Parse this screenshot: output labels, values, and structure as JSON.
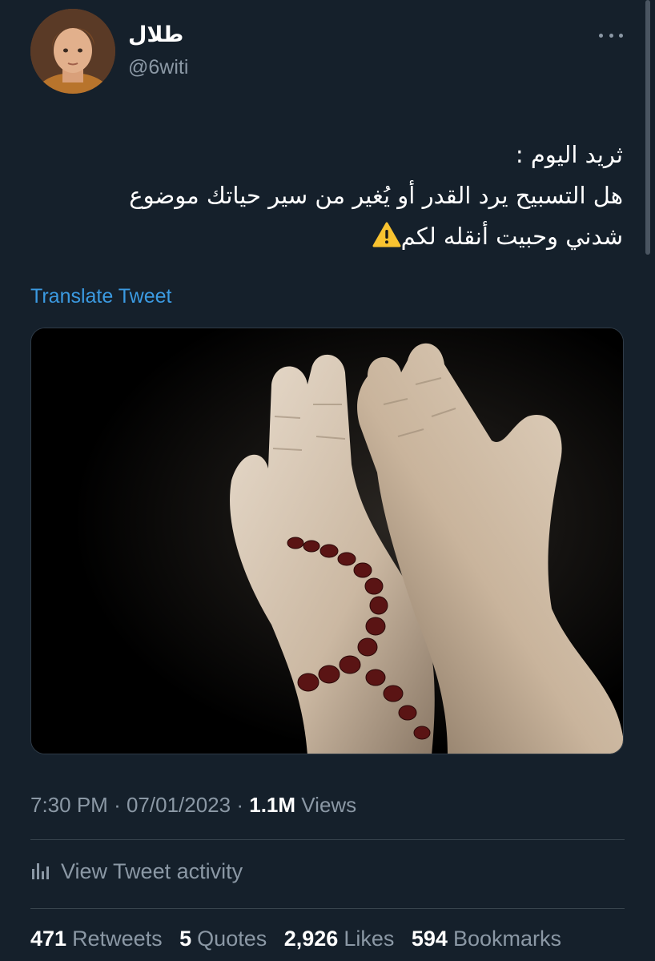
{
  "author": {
    "display_name": "طلال",
    "handle": "@6witi"
  },
  "tweet": {
    "lines": [
      "ثريد اليوم :",
      "هل التسبيح يرد القدر أو يُغير من سير حياتك موضوع",
      "شدني وحبيت أنقله لكم"
    ],
    "translate_label": "Translate Tweet",
    "media_icon": "praying-hands-with-prayer-beads-photo"
  },
  "meta": {
    "time": "7:30 PM",
    "separator": "·",
    "date": "07/01/2023",
    "views_count": "1.1M",
    "views_label": "Views"
  },
  "activity": {
    "label": "View Tweet activity",
    "icon": "bar-chart-icon"
  },
  "stats": {
    "retweets_count": "471",
    "retweets_label": "Retweets",
    "quotes_count": "5",
    "quotes_label": "Quotes",
    "likes_count": "2,926",
    "likes_label": "Likes",
    "bookmarks_count": "594",
    "bookmarks_label": "Bookmarks"
  },
  "colors": {
    "background": "#15202b",
    "link": "#3b9ae1",
    "secondary_text": "#8b98a5",
    "divider": "#38444d"
  }
}
